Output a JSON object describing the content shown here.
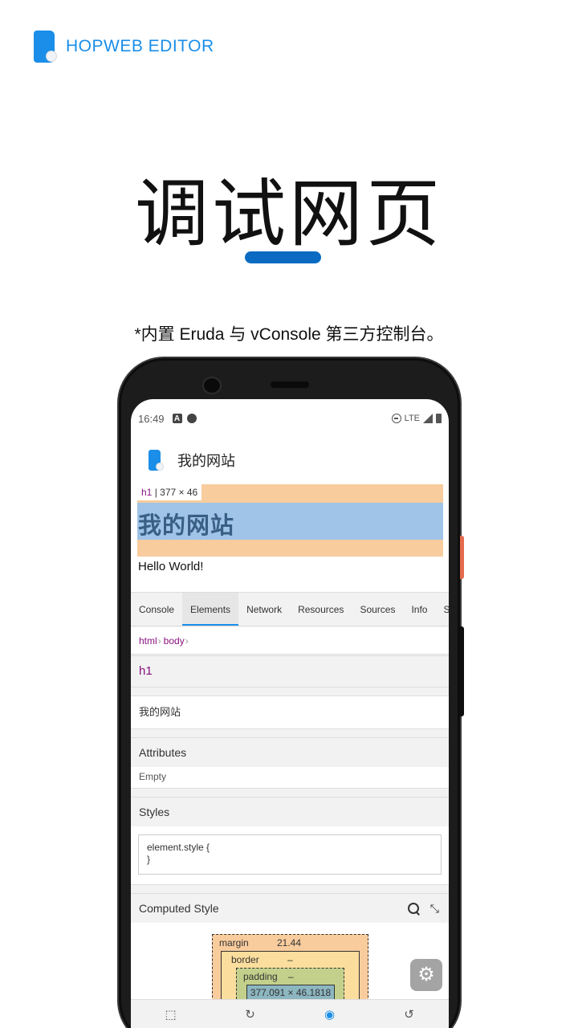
{
  "brand": {
    "name": "HOPWEB EDITOR"
  },
  "headline": "调试网页",
  "subtitle": "*内置 Eruda 与 vConsole 第三方控制台。",
  "phone": {
    "status": {
      "time": "16:49",
      "network": "LTE"
    },
    "app_title": "我的网站",
    "page": {
      "inspect_tag": "h1",
      "inspect_size": " | 377 × 46",
      "h1": "我的网站",
      "p": "Hello World!"
    },
    "devtools": {
      "tabs": [
        "Console",
        "Elements",
        "Network",
        "Resources",
        "Sources",
        "Info",
        "S"
      ],
      "active_tab": "Elements",
      "breadcrumb": [
        "html",
        "body"
      ],
      "selected_tag": "h1",
      "text_node": "我的网站",
      "attributes": {
        "title": "Attributes",
        "empty": "Empty"
      },
      "styles": {
        "title": "Styles",
        "rule_line1": "element.style {",
        "rule_line2": "}"
      },
      "computed": {
        "title": "Computed Style",
        "margin_label": "margin",
        "margin_value": "21.44",
        "border_label": "border",
        "border_value": "–",
        "padding_label": "padding",
        "padding_value": "–",
        "content_size": "377.091 × 46.1818",
        "dash": "–"
      }
    }
  },
  "colors": {
    "accent": "#1a8ee8",
    "underline": "#0b6bc2",
    "tag": "#881280"
  },
  "icons": {
    "status": [
      "a-icon",
      "circle-icon",
      "dnd-icon",
      "signal-icon",
      "battery-icon"
    ],
    "bottom_bar": [
      "select-icon",
      "refresh-icon",
      "eye-icon",
      "reset-icon"
    ],
    "fab": "gear-icon"
  }
}
